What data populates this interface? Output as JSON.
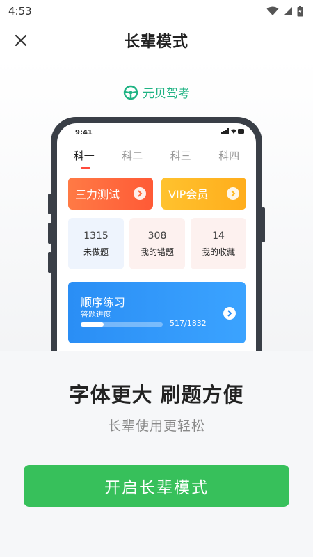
{
  "status_bar": {
    "time": "4:53",
    "icons": [
      "wifi-icon",
      "cellular-signal-icon",
      "battery-icon"
    ]
  },
  "header": {
    "title": "长辈模式",
    "close_icon": "close-icon"
  },
  "hero": {
    "brand_name": "元贝驾考",
    "brand_icon": "steering-wheel-icon",
    "brand_color": "#1fb383",
    "phone": {
      "status_time": "9:41",
      "tabs": [
        {
          "label": "科一",
          "active": true
        },
        {
          "label": "科二",
          "active": false
        },
        {
          "label": "科三",
          "active": false
        },
        {
          "label": "科四",
          "active": false
        }
      ],
      "promos": [
        {
          "label": "三力测试",
          "color": "#ff6a3d"
        },
        {
          "label": "VIP会员",
          "color": "#ffb81f"
        }
      ],
      "stats": [
        {
          "value": "1315",
          "label": "未做题"
        },
        {
          "value": "308",
          "label": "我的错题"
        },
        {
          "value": "14",
          "label": "我的收藏"
        }
      ],
      "practice": {
        "title": "顺序练习",
        "subtitle": "答题进度",
        "progress_text": "517/1832",
        "progress_fraction": 0.28
      }
    }
  },
  "sheet": {
    "headline": "字体更大 刷题方便",
    "subline": "长辈使用更轻松",
    "cta_label": "开启长辈模式",
    "cta_color": "#37c05b"
  }
}
